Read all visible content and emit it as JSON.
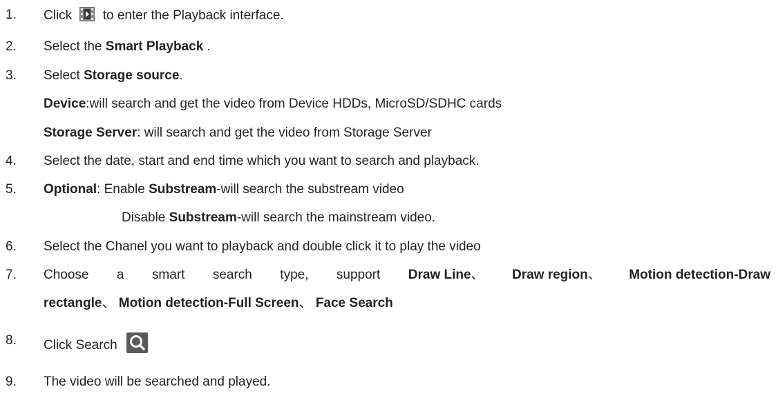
{
  "steps": [
    {
      "num": "1.",
      "pre": "Click",
      "post": "to enter the Playback interface.",
      "icon": "playback-icon"
    },
    {
      "num": "2.",
      "pre": "Select the ",
      "bold": "Smart Playback",
      "post": " ."
    },
    {
      "num": "3.",
      "pre": "Select ",
      "bold": "Storage source",
      "post": "."
    },
    {
      "device_bold": "Device",
      "device_text": ":will search and get the video from Device HDDs, MicroSD/SDHC cards"
    },
    {
      "server_bold": "Storage Server",
      "server_text": ": will search and get the video from Storage Server"
    },
    {
      "num": "4.",
      "text": "Select the date, start and end time which you want to search and playback."
    },
    {
      "num": "5.",
      "bold1": "Optional",
      "mid1": ": Enable ",
      "bold2": "Substream",
      "post": "-will search the substream video"
    },
    {
      "pre": "Disable ",
      "bold": "Substream",
      "post": "-will search the mainstream video."
    },
    {
      "num": "6.",
      "text": "Select the Chanel you want to playback and double click it to play the video"
    },
    {
      "num": "7.",
      "words": [
        "Choose",
        "a",
        "smart",
        "search",
        "type,",
        "support"
      ],
      "b1": "Draw Line",
      "sep": "、",
      "b2": "Draw region",
      "b3": "Motion detection-Draw"
    },
    {
      "b4": "rectangle",
      "b5": "Motion detection-Full Screen",
      "b6": "Face Search",
      "sep": "、"
    },
    {
      "num": "8.",
      "text": "Click Search",
      "icon": "search-icon"
    },
    {
      "num": "9.",
      "text": "The video will be searched and played."
    }
  ],
  "colors": {
    "text": "#222222",
    "icon_bg": "#5a5a5a"
  }
}
